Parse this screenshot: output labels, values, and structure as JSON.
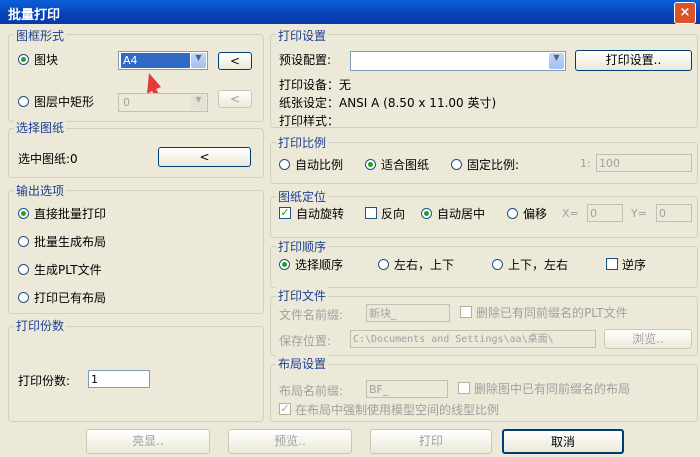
{
  "window": {
    "title": "批量打印",
    "close_glyph": "×"
  },
  "frame_group": {
    "title": "图框形式",
    "block_label": "图块",
    "block_value": "A4",
    "pick_glyph": "<",
    "layer_rect_label": "图层中矩形",
    "layer_value": "0"
  },
  "select_group": {
    "title": "选择图纸",
    "selected_text": "选中图纸:0",
    "select_glyph": "<"
  },
  "output_group": {
    "title": "输出选项",
    "options": [
      "直接批量打印",
      "批量生成布局",
      "生成PLT文件",
      "打印已有布局"
    ]
  },
  "copies_group": {
    "title": "打印份数",
    "label": "打印份数:",
    "value": "1"
  },
  "print_settings": {
    "title": "打印设置",
    "preset_label": "预设配置:",
    "preset_value": "",
    "settings_button": "打印设置..",
    "device_text": "打印设备：无",
    "paper_text": "纸张设定：ANSI A (8.50 x 11.00 英寸)",
    "style_text": "打印样式："
  },
  "scale": {
    "title": "打印比例",
    "auto_label": "自动比例",
    "fit_label": "适合图纸",
    "fixed_label": "固定比例:",
    "ratio_prefix": "1:",
    "ratio_value": "100"
  },
  "position": {
    "title": "图纸定位",
    "auto_rotate": "自动旋转",
    "reverse": "反向",
    "auto_center": "自动居中",
    "offset": "偏移",
    "x_label": "X=",
    "x_value": "0",
    "y_label": "Y=",
    "y_value": "0"
  },
  "order": {
    "title": "打印顺序",
    "select_order": "选择顺序",
    "lr_tb": "左右，上下",
    "tb_lr": "上下，左右",
    "reverse": "逆序"
  },
  "print_file": {
    "title": "打印文件",
    "prefix_label": "文件名前缀:",
    "prefix_value": "新块_",
    "delete_label": "删除已有同前缀名的PLT文件",
    "path_label": "保存位置:",
    "path_value": "C:\\Documents and Settings\\aa\\桌面\\",
    "browse": "浏览.."
  },
  "layout": {
    "title": "布局设置",
    "prefix_label": "布局名前缀:",
    "prefix_value": "BF_",
    "delete_label": "删除图中已有同前缀名的布局",
    "force_label": "在布局中强制使用模型空间的线型比例"
  },
  "footer": {
    "highlight": "亮显..",
    "preview": "预览..",
    "print": "打印",
    "cancel": "取消"
  },
  "colors": {
    "title_bar": "#0a4fc8",
    "group_title": "#1c3f94",
    "radio_dot": "#21a121",
    "arrow_annotation": "#e23b3b"
  }
}
